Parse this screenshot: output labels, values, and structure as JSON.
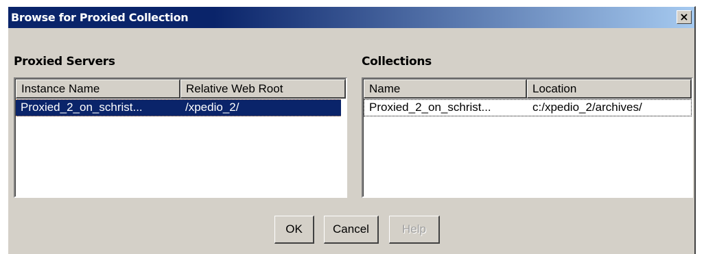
{
  "window": {
    "title": "Browse for Proxied Collection",
    "close_label": "×"
  },
  "servers": {
    "label": "Proxied Servers",
    "columns": [
      "Instance Name",
      "Relative Web Root"
    ],
    "rows": [
      {
        "instance_name": "Proxied_2_on_schrist...",
        "relative_web_root": "/xpedio_2/",
        "selected": true
      }
    ]
  },
  "collections": {
    "label": "Collections",
    "columns": [
      "Name",
      "Location"
    ],
    "rows": [
      {
        "name": "Proxied_2_on_schrist...",
        "location": "c:/xpedio_2/archives/",
        "focused": true
      }
    ]
  },
  "buttons": {
    "ok": "OK",
    "cancel": "Cancel",
    "help": "Help",
    "help_enabled": false
  },
  "colors": {
    "title_bar": "#0a246a",
    "selection": "#0a246a",
    "face": "#d4d0c8"
  }
}
